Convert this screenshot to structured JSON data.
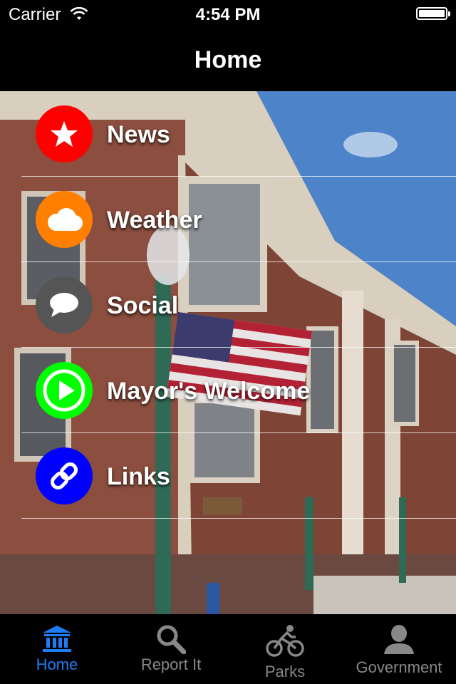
{
  "status_bar": {
    "carrier": "Carrier",
    "time": "4:54 PM"
  },
  "nav_bar": {
    "title": "Home"
  },
  "menu": {
    "items": [
      {
        "label": "News",
        "icon": "star-icon",
        "color": "#ff0000"
      },
      {
        "label": "Weather",
        "icon": "cloud-icon",
        "color": "#ff7f00"
      },
      {
        "label": "Social",
        "icon": "speech-bubble-icon",
        "color": "#555555"
      },
      {
        "label": "Mayor's Welcome",
        "icon": "play-icon",
        "color": "#00ff00"
      },
      {
        "label": "Links",
        "icon": "link-icon",
        "color": "#0000ff"
      }
    ]
  },
  "tab_bar": {
    "tabs": [
      {
        "label": "Home",
        "icon": "building-icon",
        "active": true
      },
      {
        "label": "Report It",
        "icon": "search-icon",
        "active": false
      },
      {
        "label": "Parks",
        "icon": "bicycle-icon",
        "active": false
      },
      {
        "label": "Government",
        "icon": "person-icon",
        "active": false
      }
    ],
    "active_color": "#1e7cf5",
    "inactive_color": "#888888"
  }
}
